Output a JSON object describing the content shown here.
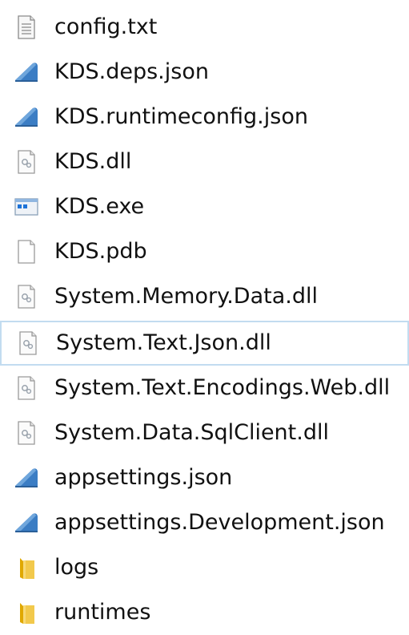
{
  "files": [
    {
      "name": "config.txt",
      "icon": "text-file-icon"
    },
    {
      "name": "KDS.deps.json",
      "icon": "json-file-icon"
    },
    {
      "name": "KDS.runtimeconfig.json",
      "icon": "json-file-icon"
    },
    {
      "name": "KDS.dll",
      "icon": "dll-file-icon"
    },
    {
      "name": "KDS.exe",
      "icon": "exe-file-icon"
    },
    {
      "name": "KDS.pdb",
      "icon": "blank-file-icon"
    },
    {
      "name": "System.Memory.Data.dll",
      "icon": "dll-file-icon"
    },
    {
      "name": "System.Text.Json.dll",
      "icon": "dll-file-icon",
      "selected": true
    },
    {
      "name": "System.Text.Encodings.Web.dll",
      "icon": "dll-file-icon"
    },
    {
      "name": "System.Data.SqlClient.dll",
      "icon": "dll-file-icon"
    },
    {
      "name": "appsettings.json",
      "icon": "json-file-icon"
    },
    {
      "name": "appsettings.Development.json",
      "icon": "json-file-icon"
    },
    {
      "name": "logs",
      "icon": "folder-icon"
    },
    {
      "name": "runtimes",
      "icon": "folder-icon"
    }
  ],
  "colors": {
    "selection_border": "#c2dcf0",
    "folder": "#f2c94c",
    "json_blue": "#3b7dc4",
    "exe_blue": "#1e73d8"
  }
}
